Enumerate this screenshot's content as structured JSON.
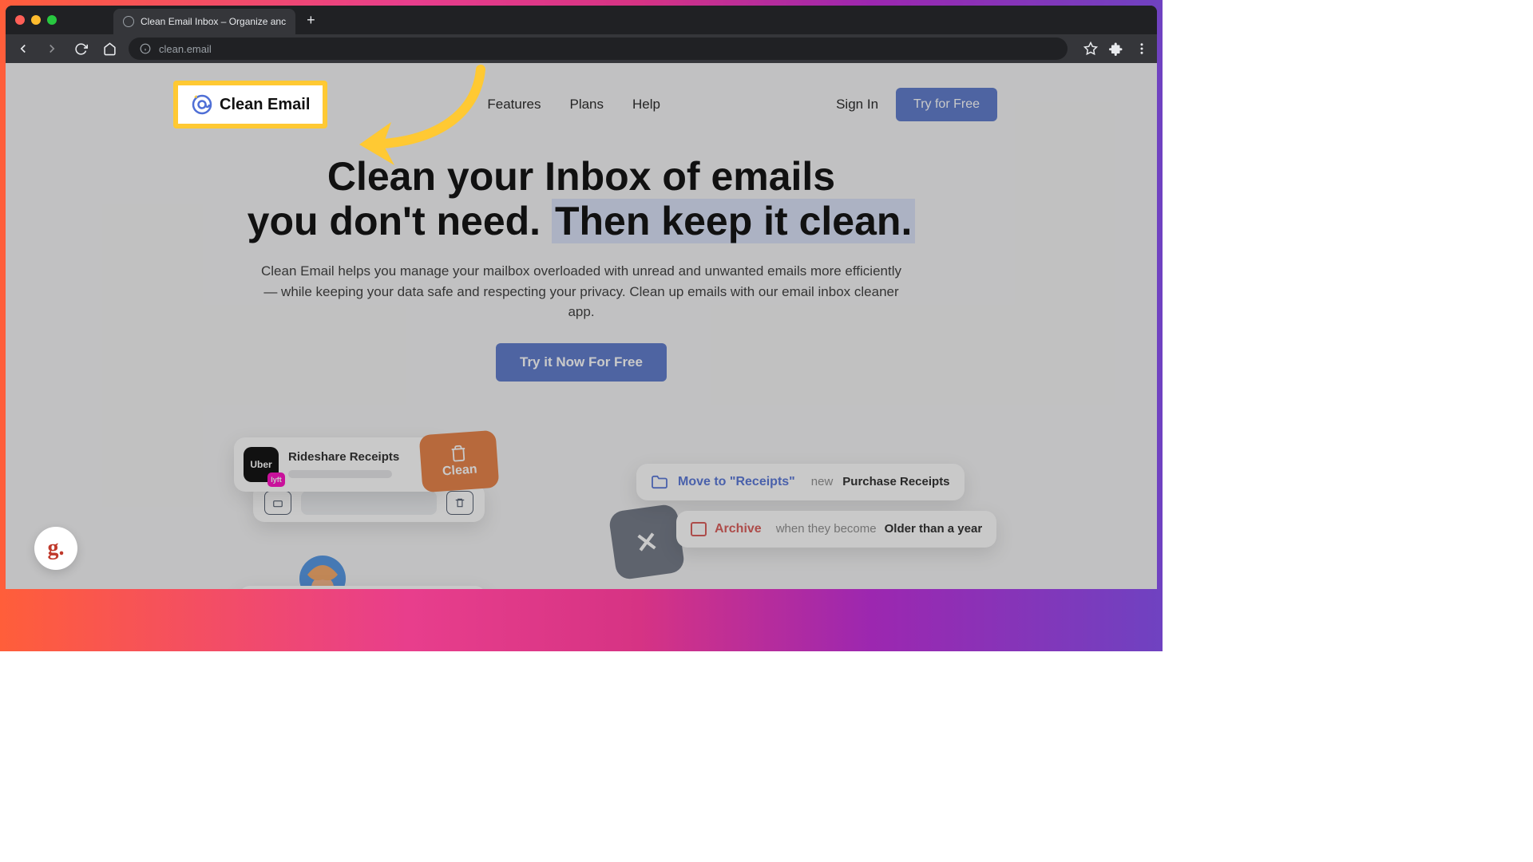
{
  "browser": {
    "tab_title": "Clean Email Inbox – Organize anc",
    "address": "clean.email"
  },
  "header": {
    "logo_text": "Clean Email",
    "nav": {
      "features": "Features",
      "plans": "Plans",
      "help": "Help"
    },
    "sign_in": "Sign In",
    "try_free": "Try for Free"
  },
  "hero": {
    "title_line1": "Clean your Inbox of emails",
    "title_line2_a": "you don't need. ",
    "title_line2_hl": "Then keep it clean.",
    "subtitle": "Clean Email helps you manage your mailbox overloaded with unread and unwanted emails more efficiently — while keeping your data safe and respecting your privacy. Clean up emails with our email inbox cleaner app.",
    "cta": "Try it Now For Free"
  },
  "cards": {
    "rideshare_title": "Rideshare Receipts",
    "uber_label": "Uber",
    "lyft_label": "lyft",
    "clean_label": "Clean",
    "move_label": "Move to \"Receipts\"",
    "move_muted": "new",
    "move_strong": "Purchase Receipts",
    "archive_label": "Archive",
    "archive_muted": "when they become",
    "archive_strong": "Older than a year"
  },
  "g_badge": "g."
}
